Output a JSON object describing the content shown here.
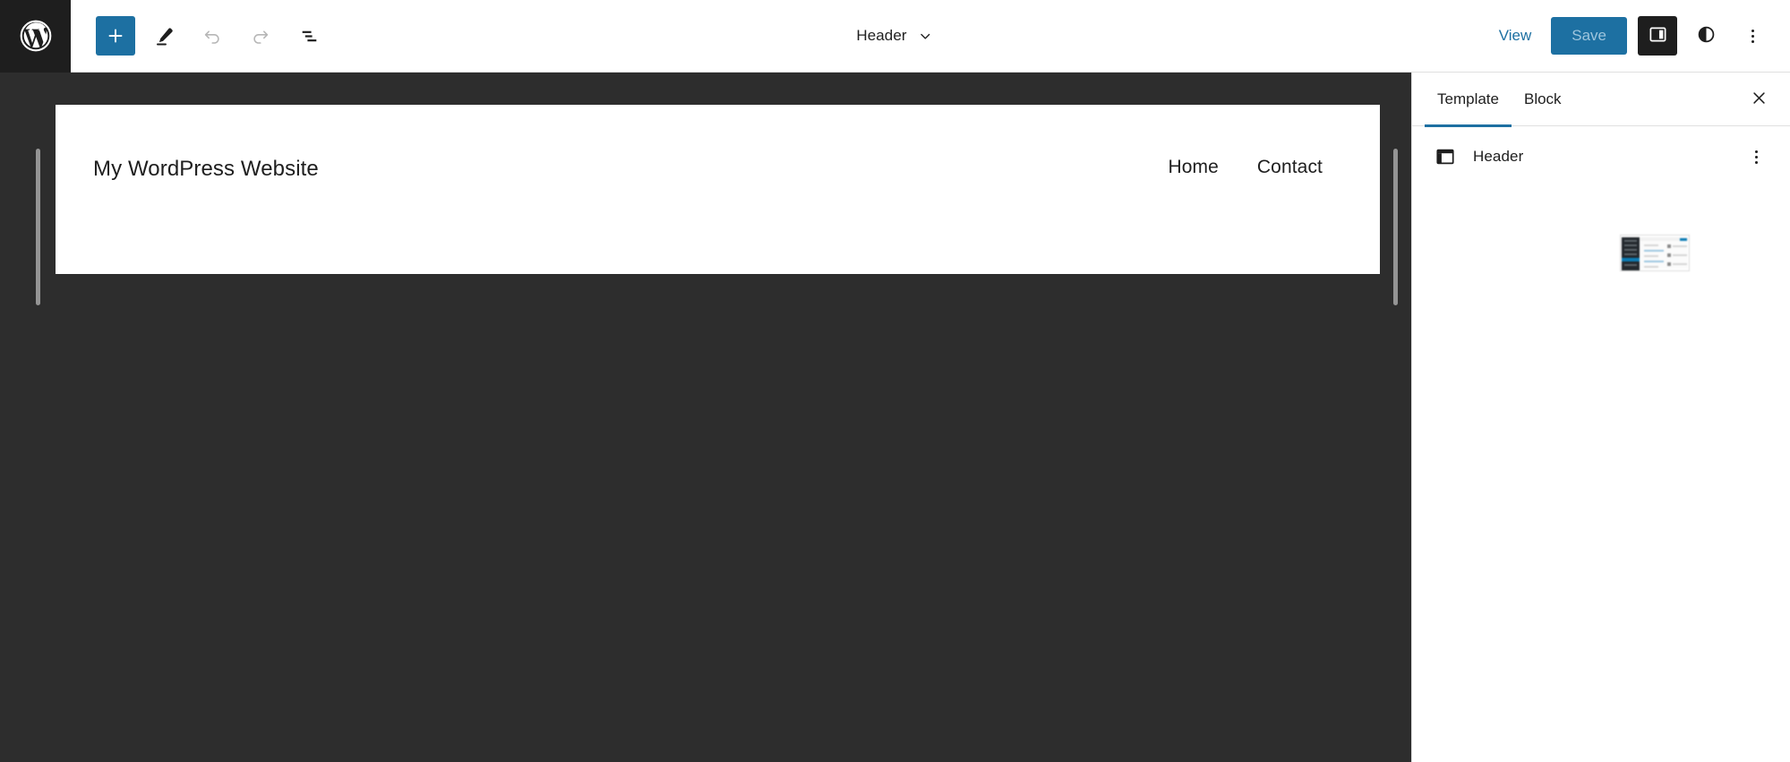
{
  "toolbar": {
    "logo_icon": "wordpress-logo-icon",
    "add_block_label": "+",
    "add_block_icon": "plus-icon",
    "edit_icon": "pencil-edit-icon",
    "undo_icon": "undo-arrow-icon",
    "redo_icon": "redo-arrow-icon",
    "list_view_icon": "document-outline-icon",
    "document_title": "Header",
    "document_chevron_icon": "chevron-down-icon",
    "view_label": "View",
    "save_label": "Save",
    "sidebar_toggle_icon": "settings-panel-icon",
    "styles_icon": "contrast-half-circle-icon",
    "options_icon": "vertical-three-dots-icon"
  },
  "canvas": {
    "left_resize_handle": "resize-handle-left",
    "right_resize_handle": "resize-handle-right",
    "site_title": "My WordPress Website",
    "nav_items": [
      {
        "label": "Home"
      },
      {
        "label": "Contact"
      }
    ]
  },
  "sidebar": {
    "tabs": [
      {
        "label": "Template",
        "active": true
      },
      {
        "label": "Block",
        "active": false
      }
    ],
    "close_icon": "close-x-icon",
    "block": {
      "icon": "header-layout-icon",
      "name": "Header",
      "menu_icon": "vertical-three-dots-icon"
    },
    "thumbnail": "template-preview-thumbnail"
  },
  "colors": {
    "accent_blue": "#1d70a2",
    "toolbar_dark": "#1e1e1e",
    "canvas_background": "#2d2d2d",
    "panel_white": "#ffffff",
    "border_gray": "#e0e0e0",
    "handle_gray": "#949494",
    "disabled_text": "#b6b6b6",
    "save_label_muted": "#9ec5dd"
  }
}
